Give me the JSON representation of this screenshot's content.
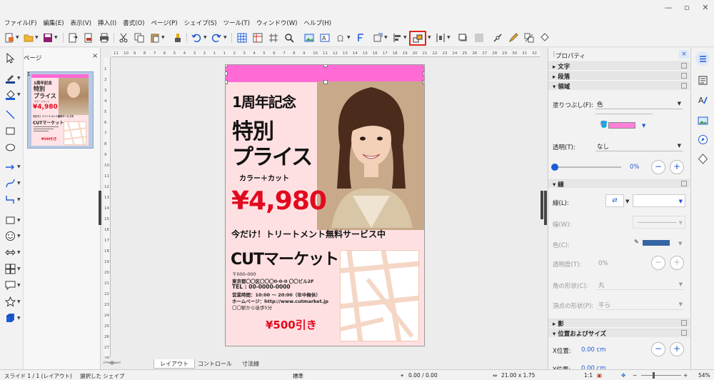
{
  "menu": [
    "ファイル(F)",
    "編集(E)",
    "表示(V)",
    "挿入(I)",
    "書式(O)",
    "ページ(P)",
    "シェイプ(S)",
    "ツール(T)",
    "ウィンドウ(W)",
    "ヘルプ(H)"
  ],
  "slide_panel": {
    "title": "ページ",
    "close": "×",
    "slide_number": "1"
  },
  "ruler": {
    "h": [
      "11",
      "10",
      "9",
      "8",
      "7",
      "6",
      "5",
      "4",
      "3",
      "2",
      "1",
      "1",
      "2",
      "3",
      "4",
      "5",
      "6",
      "7",
      "8",
      "9",
      "10",
      "11",
      "12",
      "13",
      "14",
      "15",
      "16",
      "17",
      "18",
      "19",
      "20",
      "21",
      "22",
      "23",
      "24",
      "25",
      "26",
      "27",
      "28",
      "29",
      "30",
      "31",
      "32"
    ],
    "v": [
      "1",
      "2",
      "3",
      "4",
      "5",
      "6",
      "7",
      "8",
      "9",
      "10",
      "11",
      "12",
      "13",
      "14",
      "15",
      "16",
      "17",
      "18",
      "19",
      "20",
      "21",
      "22",
      "23",
      "24",
      "25",
      "26",
      "27",
      "28"
    ]
  },
  "poster": {
    "title1": "1周年記念",
    "title2": "特別",
    "title3": "プライス",
    "service": "カラー＋カット",
    "price": "¥4,980",
    "treatment": "今だけ！トリートメント無料サービス中",
    "shop_name": "CUTマーケット",
    "postal": "〒000-000",
    "address": "東京都〇〇区〇〇〇0-0-0 〇〇ビル2F",
    "tel": "TEL : 00-0000-0000",
    "hours": "営業時間：10:00 〜 20:00（年中無休）",
    "homepage": "ホームページ：http://www.cutmarket.jp",
    "access": "〇〇駅から徒歩5分",
    "discount": "¥500引き"
  },
  "bottom_tabs": [
    "レイアウト",
    "コントロール",
    "寸法線"
  ],
  "properties": {
    "title": "プロパティ",
    "close": "×",
    "sections": {
      "text": "文字",
      "paragraph": "段落",
      "area": "領域",
      "line": "線",
      "shadow": "影",
      "position": "位置およびサイズ"
    },
    "fill_label": "塗りつぶし(F):",
    "fill_value": "色",
    "fill_color": "#ff80d8",
    "transparency_label": "透明(T):",
    "transparency_value": "なし",
    "transparency_percent": "0%",
    "line_label": "線(L):",
    "width_label": "幅(W):",
    "color_label": "色(C):",
    "line_color": "#3465a4",
    "line_transparency_label": "透明度(T):",
    "line_transparency_value": "0%",
    "corner_label": "角の形状(C):",
    "corner_value": "丸",
    "cap_label": "頂点の形状(P):",
    "cap_value": "平ら",
    "x_label": "X位置:",
    "x_value": "0.00 cm",
    "y_label": "Y位置:",
    "y_value": "0.00 cm"
  },
  "status": {
    "slide": "スライド 1 / 1 (レイアウト)",
    "selection": "選択した シェイプ",
    "style": "標準",
    "position": "0.00 / 0.00",
    "size": "21.00 x 1.75",
    "ratio": "1:1",
    "zoom": "54%"
  },
  "colors": {
    "accent": "#1e5bd6",
    "highlight": "#e2231a",
    "poster_bg": "#ffe0e2",
    "price_red": "#e10a1e"
  }
}
